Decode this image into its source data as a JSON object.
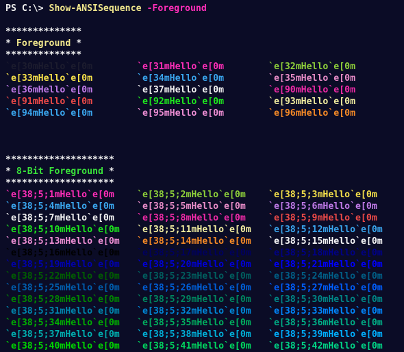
{
  "terminal": {
    "partial_top_line": "  ` ` '  ' ` ' ' ' ` ' '  ` ' ' ' '  `  '  ' '  ` ' '",
    "prompt": "PS C:\\> ",
    "command": "Show-ANSISequence",
    "parameter": "-Foreground",
    "sections": [
      {
        "border": "**************",
        "title_prefix": "* ",
        "title": "Foreground",
        "title_suffix": " *",
        "title_color": "#f0e68c",
        "rows": [
          [
            {
              "text": "`e[30mHello`e[0m",
              "color": "#1c1c2e"
            },
            {
              "text": "`e[31mHello`e[0m",
              "color": "#ff2eb8"
            },
            {
              "text": "`e[32mHello`e[0m",
              "color": "#8fd13a"
            }
          ],
          [
            {
              "text": "`e[33mHello`e[0m",
              "color": "#f5e04a"
            },
            {
              "text": "`e[34mHello`e[0m",
              "color": "#3aa6ee"
            },
            {
              "text": "`e[35mHello`e[0m",
              "color": "#e98dc8"
            }
          ],
          [
            {
              "text": "`e[36mHello`e[0m",
              "color": "#c07ae8"
            },
            {
              "text": "`e[37mHello`e[0m",
              "color": "#f2f2f2"
            },
            {
              "text": "`e[90mHello`e[0m",
              "color": "#f02aa8"
            }
          ],
          [
            {
              "text": "`e[91mHello`e[0m",
              "color": "#ee4a48"
            },
            {
              "text": "`e[92mHello`e[0m",
              "color": "#1ee81e"
            },
            {
              "text": "`e[93mHello`e[0m",
              "color": "#f2eea0"
            }
          ],
          [
            {
              "text": "`e[94mHello`e[0m",
              "color": "#3aa6ee"
            },
            {
              "text": "`e[95mHello`e[0m",
              "color": "#ee8ed4"
            },
            {
              "text": "`e[96mHello`e[0m",
              "color": "#f58a26"
            }
          ]
        ]
      },
      {
        "border": "********************",
        "title_prefix": "* ",
        "title": "8-Bit Foreground",
        "title_suffix": " *",
        "title_color": "#3ae03a",
        "rows": [
          [
            {
              "text": "`e[38;5;1mHello`e[0m",
              "color": "#ff2eb8"
            },
            {
              "text": "`e[38;5;2mHello`e[0m",
              "color": "#8fd13a"
            },
            {
              "text": "`e[38;5;3mHello`e[0m",
              "color": "#f5e04a"
            }
          ],
          [
            {
              "text": "`e[38;5;4mHello`e[0m",
              "color": "#3aa6ee"
            },
            {
              "text": "`e[38;5;5mHello`e[0m",
              "color": "#e98dc8"
            },
            {
              "text": "`e[38;5;6mHello`e[0m",
              "color": "#c07ae8"
            }
          ],
          [
            {
              "text": "`e[38;5;7mHello`e[0m",
              "color": "#f2f2f2"
            },
            {
              "text": "`e[38;5;8mHello`e[0m",
              "color": "#f02aa8"
            },
            {
              "text": "`e[38;5;9mHello`e[0m",
              "color": "#ee4a48"
            }
          ],
          [
            {
              "text": "`e[38;5;10mHello`e[0m",
              "color": "#1ee81e"
            },
            {
              "text": "`e[38;5;11mHello`e[0m",
              "color": "#f2eea0"
            },
            {
              "text": "`e[38;5;12mHello`e[0m",
              "color": "#3aa6ee"
            }
          ],
          [
            {
              "text": "`e[38;5;13mHello`e[0m",
              "color": "#ee8ed4"
            },
            {
              "text": "`e[38;5;14mHello`e[0m",
              "color": "#f58a26"
            },
            {
              "text": "`e[38;5;15mHello`e[0m",
              "color": "#f8f8f8"
            }
          ],
          [
            {
              "text": "`e[38;5;16mHello`e[0m",
              "color": "#000000"
            },
            {
              "text": "`e[38;5;17mHello`e[0m",
              "color": "#00005f"
            },
            {
              "text": "`e[38;5;18mHello`e[0m",
              "color": "#000087"
            }
          ],
          [
            {
              "text": "`e[38;5;19mHello`e[0m",
              "color": "#0000af"
            },
            {
              "text": "`e[38;5;20mHello`e[0m",
              "color": "#0000d7"
            },
            {
              "text": "`e[38;5;21mHello`e[0m",
              "color": "#0000ff"
            }
          ],
          [
            {
              "text": "`e[38;5;22mHello`e[0m",
              "color": "#005f00"
            },
            {
              "text": "`e[38;5;23mHello`e[0m",
              "color": "#005f5f"
            },
            {
              "text": "`e[38;5;24mHello`e[0m",
              "color": "#005f87"
            }
          ],
          [
            {
              "text": "`e[38;5;25mHello`e[0m",
              "color": "#005faf"
            },
            {
              "text": "`e[38;5;26mHello`e[0m",
              "color": "#005fd7"
            },
            {
              "text": "`e[38;5;27mHello`e[0m",
              "color": "#005fff"
            }
          ],
          [
            {
              "text": "`e[38;5;28mHello`e[0m",
              "color": "#008700"
            },
            {
              "text": "`e[38;5;29mHello`e[0m",
              "color": "#00875f"
            },
            {
              "text": "`e[38;5;30mHello`e[0m",
              "color": "#008787"
            }
          ],
          [
            {
              "text": "`e[38;5;31mHello`e[0m",
              "color": "#0087af"
            },
            {
              "text": "`e[38;5;32mHello`e[0m",
              "color": "#0087d7"
            },
            {
              "text": "`e[38;5;33mHello`e[0m",
              "color": "#0087ff"
            }
          ],
          [
            {
              "text": "`e[38;5;34mHello`e[0m",
              "color": "#00af00"
            },
            {
              "text": "`e[38;5;35mHello`e[0m",
              "color": "#00af5f"
            },
            {
              "text": "`e[38;5;36mHello`e[0m",
              "color": "#00af87"
            }
          ],
          [
            {
              "text": "`e[38;5;37mHello`e[0m",
              "color": "#00afaf"
            },
            {
              "text": "`e[38;5;38mHello`e[0m",
              "color": "#00afd7"
            },
            {
              "text": "`e[38;5;39mHello`e[0m",
              "color": "#00afff"
            }
          ],
          [
            {
              "text": "`e[38;5;40mHello`e[0m",
              "color": "#00d700"
            },
            {
              "text": "`e[38;5;41mHello`e[0m",
              "color": "#00d75f"
            },
            {
              "text": "`e[38;5;42mHello`e[0m",
              "color": "#00d787"
            }
          ]
        ]
      }
    ]
  }
}
